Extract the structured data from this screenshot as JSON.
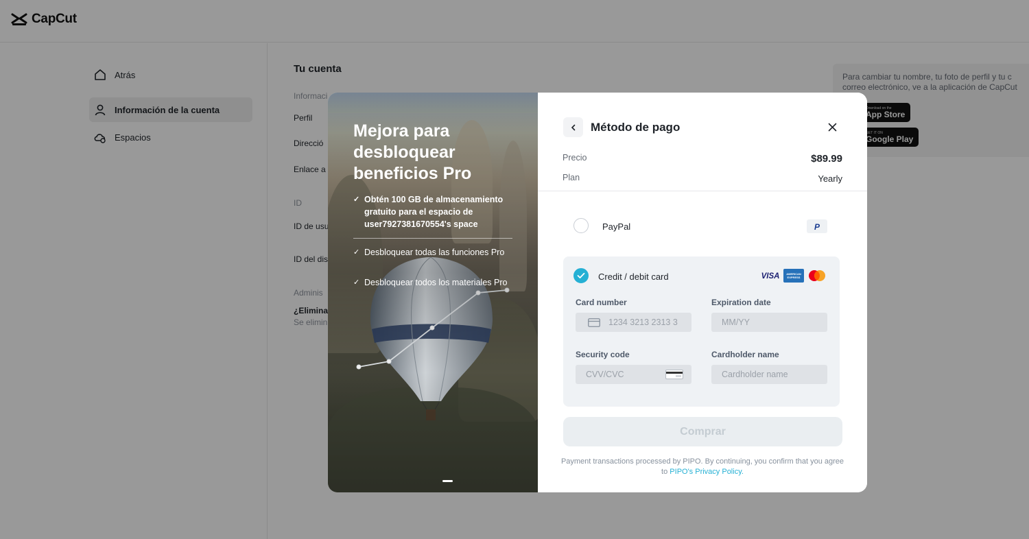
{
  "app": {
    "name": "CapCut"
  },
  "sidebar": {
    "items": [
      {
        "label": "Atrás",
        "icon": "home-icon"
      },
      {
        "label": "Información de la cuenta",
        "icon": "user-icon",
        "active": true
      },
      {
        "label": "Espacios",
        "icon": "cloud-icon"
      }
    ]
  },
  "main": {
    "title": "Tu cuenta",
    "rows": [
      "Informaci",
      "Perfil",
      "Direcció",
      "Enlace a",
      "ID",
      "ID de usu",
      "ID del dis",
      "Adminis",
      "¿Elimina",
      "Se elimin"
    ]
  },
  "info_panel": {
    "line1": "Para cambiar tu nombre, tu foto de perfil y tu c",
    "line2": "correo electrónico, ve a la aplicación de CapCut",
    "app_store_small": "Download on the",
    "app_store_big": "App Store",
    "google_small": "GET IT ON",
    "google_big": "Google Play"
  },
  "promo": {
    "title": "Mejora para desbloquear beneficios Pro",
    "benefits": [
      "Obtén 100 GB de almacenamiento gratuito para el espacio de user7927381670554's space",
      "Desbloquear todas las funciones Pro",
      "Desbloquear todos los materiales Pro"
    ]
  },
  "payment": {
    "title": "Método de pago",
    "price_label": "Precio",
    "price_value": "$89.99",
    "plan_label": "Plan",
    "plan_value": "Yearly",
    "paypal_label": "PayPal",
    "card_label": "Credit / debit card",
    "visa_text": "VISA",
    "amex_text": "AMERICAN EXPRESS",
    "card_number_label": "Card number",
    "card_number_placeholder": "1234 3213 2313 3",
    "expiration_label": "Expiration date",
    "expiration_placeholder": "MM/YY",
    "security_label": "Security code",
    "security_placeholder": "CVV/CVC",
    "cardholder_label": "Cardholder name",
    "cardholder_placeholder": "Cardholder name",
    "buy_label": "Comprar",
    "footer_text": "Payment transactions processed by PIPO. By continuing, you confirm that you agree to",
    "footer_link": "PIPO's Privacy Policy",
    "footer_end": "."
  },
  "colors": {
    "accent": "#25b0d4",
    "overlay": "rgba(0,0,0,0.40)"
  }
}
